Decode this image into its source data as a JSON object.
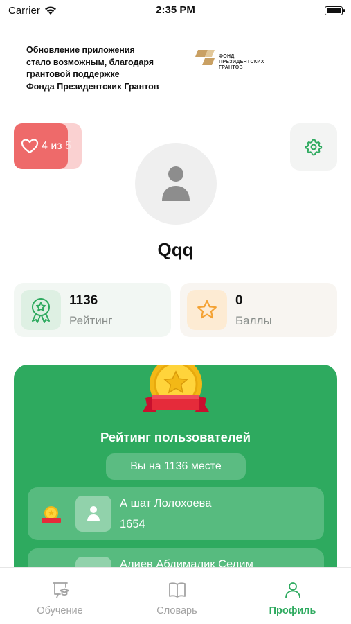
{
  "status_bar": {
    "carrier": "Carrier",
    "time": "2:35 PM"
  },
  "banner": {
    "lines": [
      "Обновление приложения",
      "стало возможным, благодаря",
      "грантовой поддержке",
      "Фонда Президентских Грантов"
    ],
    "logo_lines": [
      "ФОНД",
      "ПРЕЗИДЕНТСКИХ",
      "ГРАНТОВ"
    ]
  },
  "hearts": {
    "current": "4 из",
    "total": "5",
    "icon": "heart-icon"
  },
  "settings": {
    "icon": "gear-icon"
  },
  "profile": {
    "username": "Qqq"
  },
  "stats": {
    "rating": {
      "value": "1136",
      "label": "Рейтинг",
      "icon": "award-ribbon-icon"
    },
    "points": {
      "value": "0",
      "label": "Баллы",
      "icon": "star-icon"
    }
  },
  "leaderboard": {
    "title": "Рейтинг пользователей",
    "place_text": "Вы на 1136 месте",
    "rows": [
      {
        "name": "А шат Лолохоева",
        "score": "1654"
      },
      {
        "name": "Алиев Абдималик Селим",
        "score": ""
      }
    ]
  },
  "tabs": [
    {
      "label": "Обучение",
      "icon": "graduation-board-icon",
      "active": false
    },
    {
      "label": "Словарь",
      "icon": "book-icon",
      "active": false
    },
    {
      "label": "Профиль",
      "icon": "person-icon",
      "active": true
    }
  ],
  "colors": {
    "accent_green": "#2eaa5f",
    "heart_red": "#ee6a6a",
    "star_orange": "#f4a233"
  }
}
